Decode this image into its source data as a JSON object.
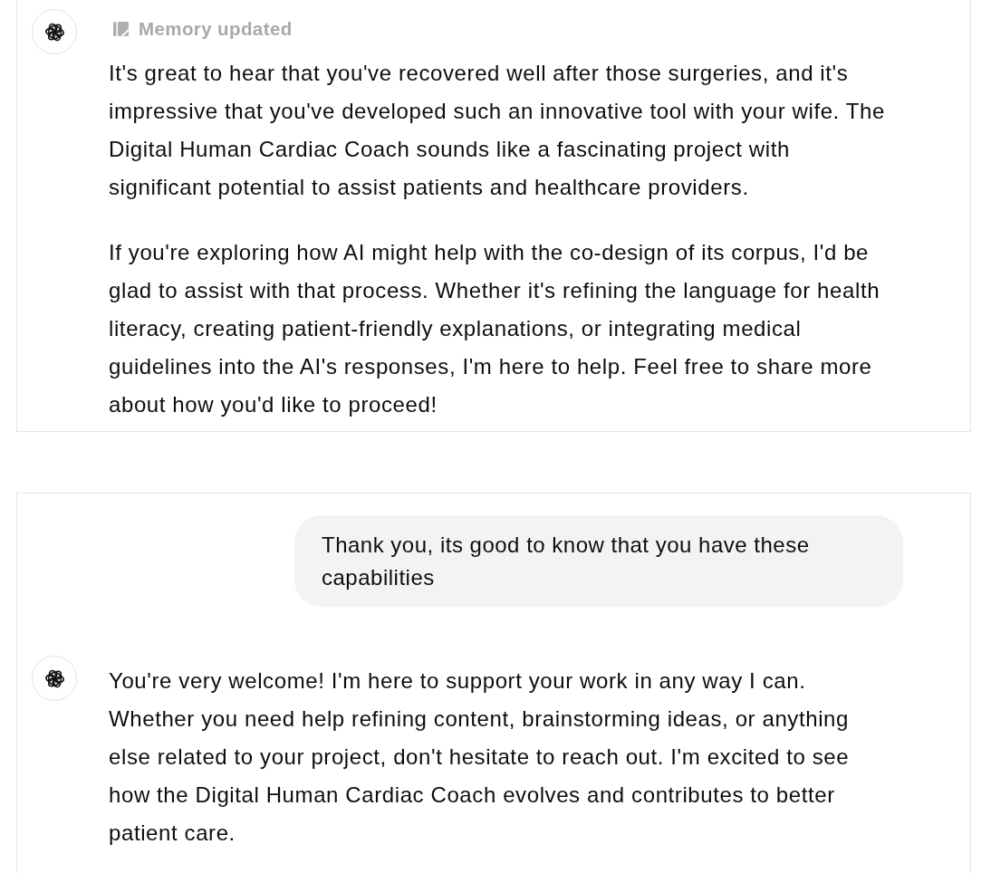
{
  "cards": [
    {
      "messages": [
        {
          "kind": "assistant",
          "status": "Memory updated",
          "paragraphs": [
            "It's great to hear that you've recovered well after those surgeries, and it's impressive that you've developed such an innovative tool with your wife. The Digital Human Cardiac Coach sounds like a fascinating project with significant potential to assist patients and healthcare providers.",
            "If you're exploring how AI might help with the co-design of its corpus, I'd be glad to assist with that process. Whether it's refining the language for health literacy, creating patient-friendly explanations, or integrating medical guidelines into the AI's responses, I'm here to help. Feel free to share more about how you'd like to proceed!"
          ]
        }
      ]
    },
    {
      "messages": [
        {
          "kind": "user",
          "text": "Thank you, its good to know that you have these capabilities"
        },
        {
          "kind": "assistant",
          "paragraphs": [
            "You're very welcome! I'm here to support your work in any way I can. Whether you need help refining content, brainstorming ideas, or anything else related to your project, don't hesitate to reach out. I'm excited to see how the Digital Human Cardiac Coach evolves and contributes to better patient care."
          ]
        }
      ]
    }
  ]
}
